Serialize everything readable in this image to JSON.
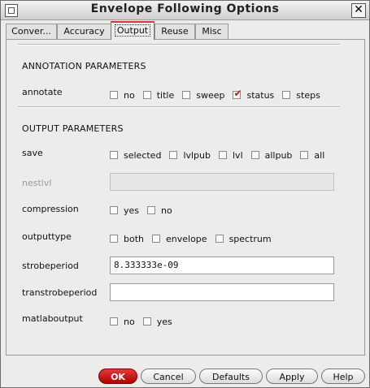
{
  "window": {
    "title": "Envelope Following Options",
    "close_label": "✕"
  },
  "tabs": [
    {
      "label": "Conver..."
    },
    {
      "label": "Accuracy"
    },
    {
      "label": "Output"
    },
    {
      "label": "Reuse"
    },
    {
      "label": "Misc"
    }
  ],
  "annotation": {
    "title": "ANNOTATION PARAMETERS",
    "label": "annotate",
    "options": [
      {
        "label": "no",
        "checked": false
      },
      {
        "label": "title",
        "checked": false
      },
      {
        "label": "sweep",
        "checked": false
      },
      {
        "label": "status",
        "checked": true
      },
      {
        "label": "steps",
        "checked": false
      }
    ]
  },
  "output": {
    "title": "OUTPUT PARAMETERS",
    "save": {
      "label": "save",
      "options": [
        "selected",
        "lvlpub",
        "lvl",
        "allpub",
        "all"
      ]
    },
    "nestlvl": {
      "label": "nestlvl",
      "value": ""
    },
    "compression": {
      "label": "compression",
      "options": [
        "yes",
        "no"
      ]
    },
    "outputtype": {
      "label": "outputtype",
      "options": [
        "both",
        "envelope",
        "spectrum"
      ]
    },
    "strobeperiod": {
      "label": "strobeperiod",
      "value": "8.333333e-09"
    },
    "transtrobeperiod": {
      "label": "transtrobeperiod",
      "value": ""
    },
    "matlaboutput": {
      "label": "matlaboutput",
      "options": [
        "no",
        "yes"
      ]
    }
  },
  "buttons": {
    "ok": "OK",
    "cancel": "Cancel",
    "defaults": "Defaults",
    "apply": "Apply",
    "help": "Help"
  },
  "colors": {
    "accent": "#d11a1a",
    "background": "#ececec"
  }
}
